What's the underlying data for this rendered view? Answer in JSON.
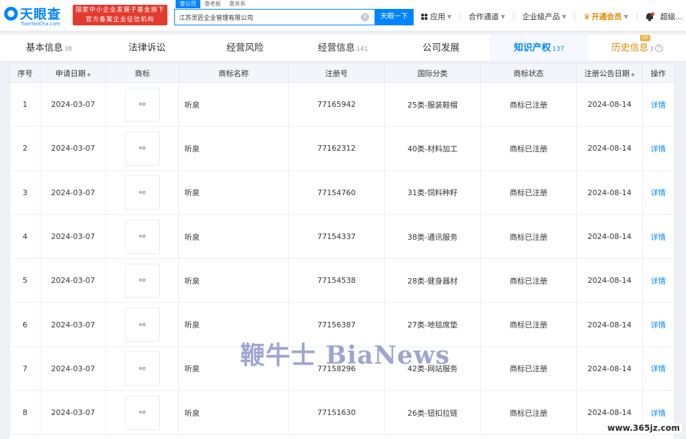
{
  "header": {
    "logo_text": "天眼查",
    "logo_sub": "TianYanCha.com",
    "gov_badge_line1": "国家中小企业发展子基金旗下",
    "gov_badge_line2": "官方备案企业征信机构",
    "search_tabs": [
      "查公司",
      "查老板",
      "查关系"
    ],
    "search_value": "江苏灵匠企业管理有限公司",
    "search_button": "天眼一下",
    "nav": {
      "apps": "应用",
      "partner": "合作通道",
      "enterprise": "企业级产品",
      "vip": "开通会员",
      "user": "超级..."
    }
  },
  "tabs": [
    {
      "label": "基本信息",
      "count": "38"
    },
    {
      "label": "法律诉讼",
      "count": ""
    },
    {
      "label": "经营风险",
      "count": ""
    },
    {
      "label": "经营信息",
      "count": "141"
    },
    {
      "label": "公司发展",
      "count": ""
    },
    {
      "label": "知识产权",
      "count": "137"
    },
    {
      "label": "历史信息",
      "count": "3"
    }
  ],
  "history_tag": "VIP",
  "table": {
    "columns": [
      "序号",
      "申请日期",
      "商标",
      "商标名称",
      "注册号",
      "国际分类",
      "商标状态",
      "注册公告日期",
      "操作"
    ],
    "thumb_text": "听泉",
    "rows": [
      {
        "no": "1",
        "apply_date": "2024-03-07",
        "name": "听泉",
        "reg_no": "77165942",
        "class": "25类-服装鞋帽",
        "status": "商标已注册",
        "pub_date": "2024-08-14",
        "action": "详情"
      },
      {
        "no": "2",
        "apply_date": "2024-03-07",
        "name": "听泉",
        "reg_no": "77162312",
        "class": "40类-材料加工",
        "status": "商标已注册",
        "pub_date": "2024-08-14",
        "action": "详情"
      },
      {
        "no": "3",
        "apply_date": "2024-03-07",
        "name": "听泉",
        "reg_no": "77154760",
        "class": "31类-饲料种籽",
        "status": "商标已注册",
        "pub_date": "2024-08-14",
        "action": "详情"
      },
      {
        "no": "4",
        "apply_date": "2024-03-07",
        "name": "听泉",
        "reg_no": "77154337",
        "class": "38类-通讯服务",
        "status": "商标已注册",
        "pub_date": "2024-08-14",
        "action": "详情"
      },
      {
        "no": "5",
        "apply_date": "2024-03-07",
        "name": "听泉",
        "reg_no": "77154538",
        "class": "28类-健身器材",
        "status": "商标已注册",
        "pub_date": "2024-08-14",
        "action": "详情"
      },
      {
        "no": "6",
        "apply_date": "2024-03-07",
        "name": "听泉",
        "reg_no": "77156387",
        "class": "27类-地毯席垫",
        "status": "商标已注册",
        "pub_date": "2024-08-14",
        "action": "详情"
      },
      {
        "no": "7",
        "apply_date": "2024-03-07",
        "name": "听泉",
        "reg_no": "77158296",
        "class": "42类-网站服务",
        "status": "商标已注册",
        "pub_date": "2024-08-14",
        "action": "详情"
      },
      {
        "no": "8",
        "apply_date": "2024-03-07",
        "name": "听泉",
        "reg_no": "77151630",
        "class": "26类-钮扣拉链",
        "status": "商标已注册",
        "pub_date": "2024-08-14",
        "action": "详情"
      }
    ]
  },
  "watermark": "鞭牛士 BiaNews",
  "site_watermark": "www.365jz.com"
}
